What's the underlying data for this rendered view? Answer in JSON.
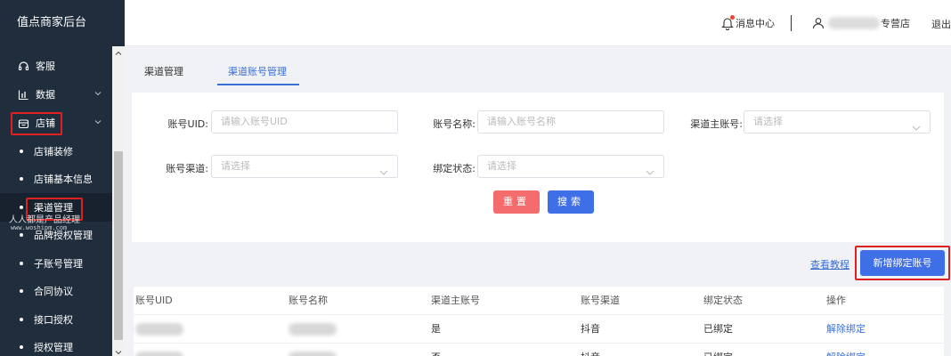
{
  "app": {
    "brand": "值点商家后台"
  },
  "sidebar": {
    "items": [
      {
        "label": "客服",
        "icon": "headset-icon"
      },
      {
        "label": "数据",
        "icon": "bar-chart-icon"
      },
      {
        "label": "店铺",
        "icon": "store-icon"
      }
    ],
    "sub_items": [
      {
        "label": "店铺装修"
      },
      {
        "label": "店铺基本信息"
      },
      {
        "label": "渠道管理"
      },
      {
        "label": "品牌授权管理"
      },
      {
        "label": "子账号管理"
      },
      {
        "label": "合同协议"
      },
      {
        "label": "接口授权"
      },
      {
        "label": "授权管理"
      }
    ],
    "watermark": "人人都是产品经理",
    "watermark_url": "www.woshipm.com"
  },
  "header": {
    "message_center": "消息中心",
    "user_suffix": "专营店",
    "logout": "退出"
  },
  "tabs": [
    {
      "label": "渠道管理"
    },
    {
      "label": "渠道账号管理"
    }
  ],
  "filters": {
    "account_uid": {
      "label": "账号UID:",
      "placeholder": "请输入账号UID"
    },
    "account_name": {
      "label": "账号名称:",
      "placeholder": "请输入账号名称"
    },
    "channel_main_account": {
      "label": "渠道主账号:",
      "placeholder": "请选择"
    },
    "account_channel": {
      "label": "账号渠道:",
      "placeholder": "请选择"
    },
    "bind_status": {
      "label": "绑定状态:",
      "placeholder": "请选择"
    },
    "reset_label": "重置",
    "search_label": "搜索"
  },
  "actions": {
    "tutorial_link": "查看教程",
    "add_binding_label": "新增绑定账号"
  },
  "table": {
    "columns": [
      "账号UID",
      "账号名称",
      "渠道主账号",
      "账号渠道",
      "绑定状态",
      "操作"
    ],
    "rows": [
      {
        "uid": "",
        "name": "",
        "main_account": "是",
        "channel": "抖音",
        "status": "已绑定",
        "op": "解除绑定"
      },
      {
        "uid": "",
        "name": "",
        "main_account": "否",
        "channel": "抖音",
        "status": "已绑定",
        "op": "解除绑定"
      }
    ]
  },
  "colors": {
    "sidebar_bg": "#1f2d3d",
    "primary": "#3f6fe6",
    "danger": "#f56c6c",
    "highlight": "#e02020"
  }
}
